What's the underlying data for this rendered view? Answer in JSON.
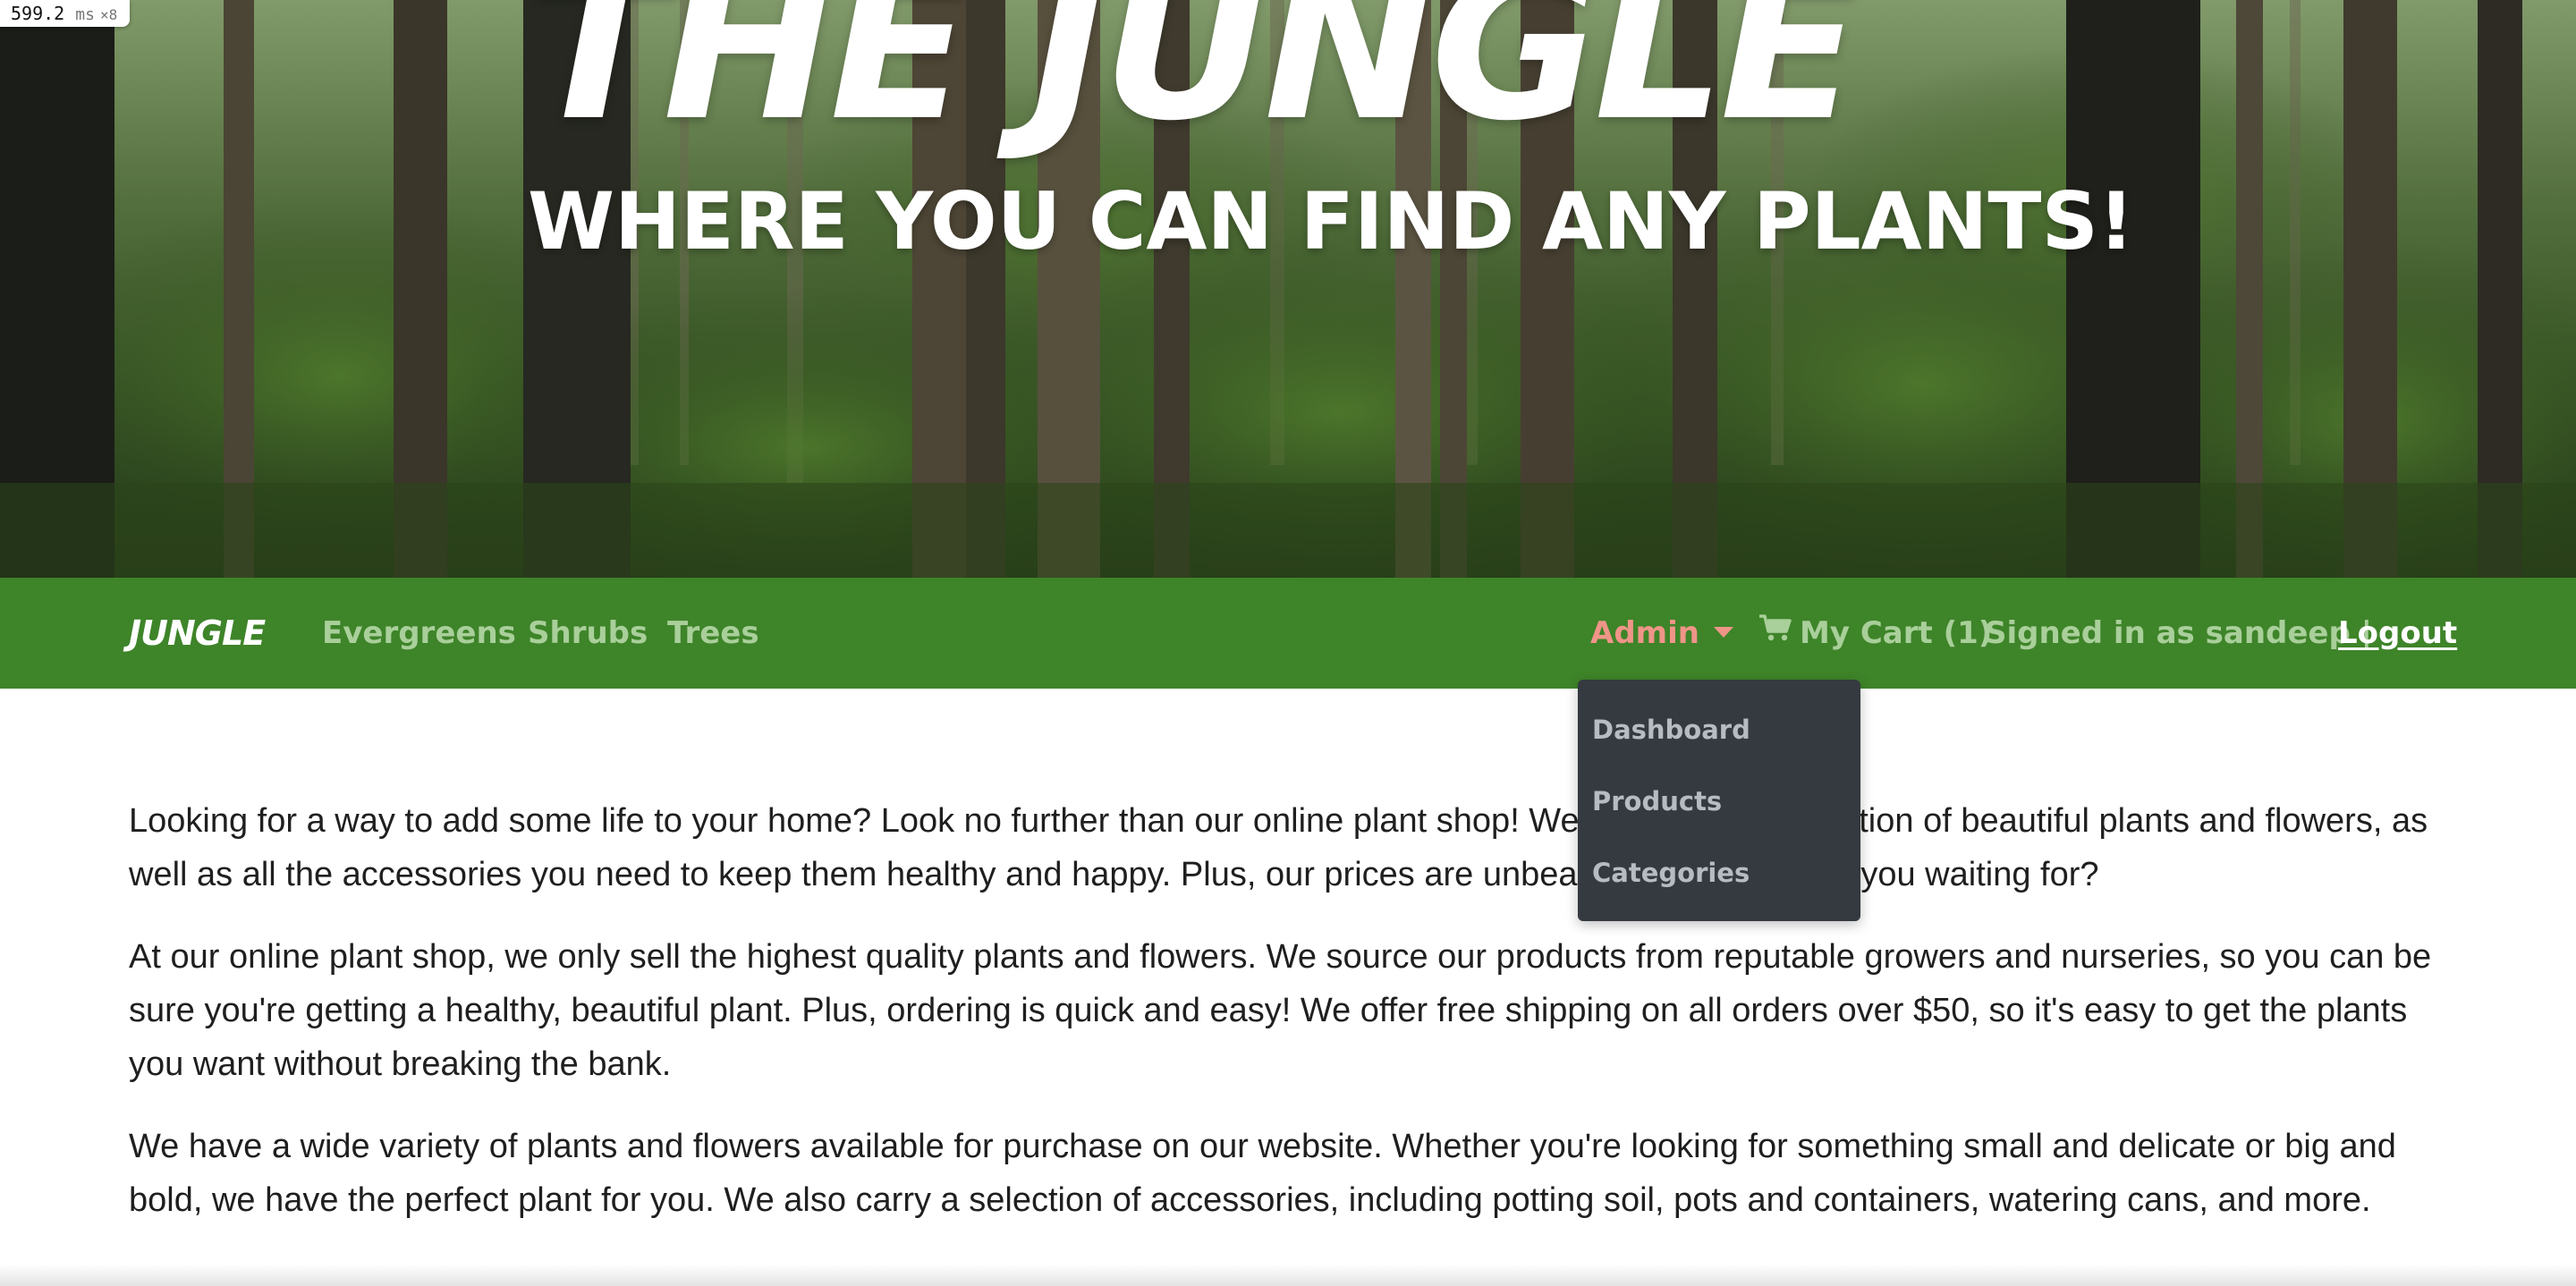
{
  "perf_badge": {
    "value": "599.2",
    "unit": "ms",
    "multiplier": "×8"
  },
  "hero": {
    "title": "THE JUNGLE",
    "subtitle": "WHERE YOU CAN FIND ANY PLANTS!"
  },
  "navbar": {
    "brand": "JUNGLE",
    "links": [
      "Evergreens",
      "Shrubs",
      "Trees"
    ],
    "admin_label": "Admin",
    "cart_label": "My Cart (1)",
    "signed_in_text": "Signed in as sandeep |",
    "logout_label": "Logout",
    "colors": {
      "background": "#3e8429",
      "link": "#a9cf9a",
      "admin": "#ef9588"
    },
    "icons": {
      "cart": "shopping-cart-icon",
      "admin_caret": "caret-down-icon"
    }
  },
  "admin_dropdown": {
    "items": [
      "Dashboard",
      "Products",
      "Categories"
    ],
    "background": "#343a40"
  },
  "content": {
    "paragraphs": [
      "Looking for a way to add some life to your home? Look no further than our online plant shop! We have a wide selection of beautiful plants and flowers, as well as all the accessories you need to keep them healthy and happy. Plus, our prices are unbeatable! So what are you waiting for?",
      "At our online plant shop, we only sell the highest quality plants and flowers. We source our products from reputable growers and nurseries, so you can be sure you're getting a healthy, beautiful plant. Plus, ordering is quick and easy! We offer free shipping on all orders over $50, so it's easy to get the plants you want without breaking the bank.",
      "We have a wide variety of plants and flowers available for purchase on our website. Whether you're looking for something small and delicate or big and bold, we have the perfect plant for you. We also carry a selection of accessories, including potting soil, pots and containers, watering cans, and more."
    ]
  }
}
